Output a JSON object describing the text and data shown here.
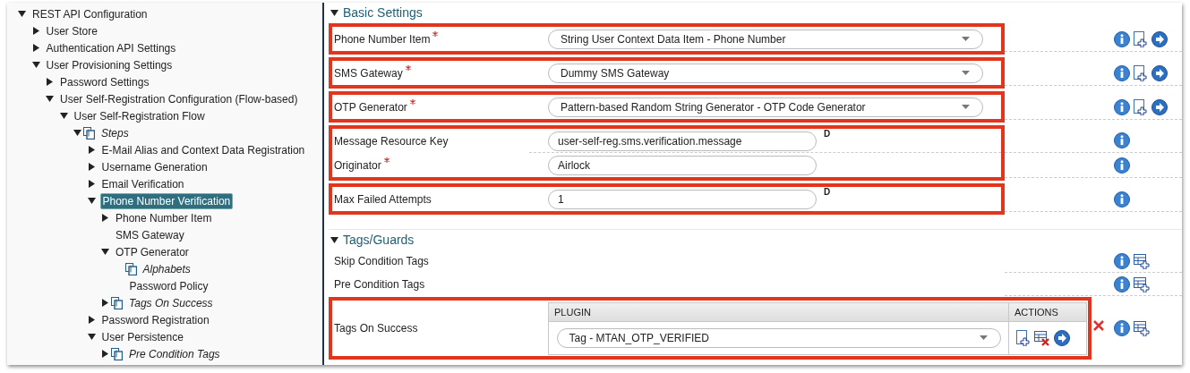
{
  "tree": [
    {
      "label": "REST API Configuration",
      "kind": "branch",
      "expanded": true,
      "collection": false,
      "selected": false,
      "children": [
        {
          "label": "User Store",
          "kind": "branch",
          "expanded": false,
          "collection": false,
          "selected": false
        },
        {
          "label": "Authentication API Settings",
          "kind": "branch",
          "expanded": false,
          "collection": false,
          "selected": false
        },
        {
          "label": "User Provisioning Settings",
          "kind": "branch",
          "expanded": true,
          "collection": false,
          "selected": false,
          "children": [
            {
              "label": "Password Settings",
              "kind": "branch",
              "expanded": false,
              "collection": false,
              "selected": false
            },
            {
              "label": "User Self-Registration Configuration (Flow-based)",
              "kind": "branch",
              "expanded": true,
              "collection": false,
              "selected": false,
              "children": [
                {
                  "label": "User Self-Registration Flow",
                  "kind": "branch",
                  "expanded": true,
                  "collection": false,
                  "selected": false,
                  "children": [
                    {
                      "label": "Steps",
                      "kind": "branch",
                      "expanded": true,
                      "collection": true,
                      "selected": false,
                      "children": [
                        {
                          "label": "E-Mail Alias and Context Data Registration",
                          "kind": "branch",
                          "expanded": false,
                          "collection": false,
                          "selected": false
                        },
                        {
                          "label": "Username Generation",
                          "kind": "branch",
                          "expanded": false,
                          "collection": false,
                          "selected": false
                        },
                        {
                          "label": "Email Verification",
                          "kind": "branch",
                          "expanded": false,
                          "collection": false,
                          "selected": false
                        },
                        {
                          "label": "Phone Number Verification",
                          "kind": "branch",
                          "expanded": true,
                          "collection": false,
                          "selected": true,
                          "children": [
                            {
                              "label": "Phone Number Item",
                              "kind": "branch",
                              "expanded": false,
                              "collection": false,
                              "selected": false
                            },
                            {
                              "label": "SMS Gateway",
                              "kind": "leaf",
                              "collection": false,
                              "selected": false
                            },
                            {
                              "label": "OTP Generator",
                              "kind": "branch",
                              "expanded": true,
                              "collection": false,
                              "selected": false,
                              "children": [
                                {
                                  "label": "Alphabets",
                                  "kind": "leaf",
                                  "collection": true,
                                  "selected": false
                                },
                                {
                                  "label": "Password Policy",
                                  "kind": "leaf",
                                  "collection": false,
                                  "selected": false
                                }
                              ]
                            },
                            {
                              "label": "Tags On Success",
                              "kind": "branch",
                              "expanded": false,
                              "collection": true,
                              "selected": false
                            }
                          ]
                        },
                        {
                          "label": "Password Registration",
                          "kind": "branch",
                          "expanded": false,
                          "collection": false,
                          "selected": false
                        },
                        {
                          "label": "User Persistence",
                          "kind": "branch",
                          "expanded": true,
                          "collection": false,
                          "selected": false,
                          "children": [
                            {
                              "label": "Pre Condition Tags",
                              "kind": "branch",
                              "expanded": false,
                              "collection": true,
                              "selected": false
                            }
                          ]
                        }
                      ]
                    }
                  ]
                }
              ]
            }
          ]
        }
      ]
    }
  ],
  "sections": [
    {
      "title": "Basic Settings",
      "expanded": true,
      "groups": [
        {
          "highlighted": true,
          "rows": [
            {
              "label": "Phone Number Item",
              "required": true,
              "field": {
                "kind": "select",
                "value": "String User Context Data Item - Phone Number"
              },
              "actions": [
                {
                  "kind": "info"
                },
                {
                  "kind": "add"
                },
                {
                  "kind": "goto"
                }
              ]
            }
          ]
        },
        {
          "highlighted": true,
          "rows": [
            {
              "label": "SMS Gateway",
              "required": true,
              "field": {
                "kind": "select",
                "value": "Dummy SMS Gateway"
              },
              "actions": [
                {
                  "kind": "info"
                },
                {
                  "kind": "add"
                },
                {
                  "kind": "goto"
                }
              ]
            }
          ]
        },
        {
          "highlighted": true,
          "rows": [
            {
              "label": "OTP Generator",
              "required": true,
              "field": {
                "kind": "select",
                "value": "Pattern-based Random String Generator - OTP Code Generator"
              },
              "actions": [
                {
                  "kind": "info"
                },
                {
                  "kind": "add"
                },
                {
                  "kind": "goto"
                }
              ]
            }
          ]
        },
        {
          "highlighted": true,
          "rows": [
            {
              "label": "Message Resource Key",
              "required": false,
              "field": {
                "kind": "text",
                "value": "user-self-reg.sms.verification.message"
              },
              "marker": "D",
              "actions": [
                {
                  "kind": "info"
                }
              ]
            },
            {
              "label": "Originator",
              "required": true,
              "field": {
                "kind": "text",
                "value": "Airlock"
              },
              "actions": [
                {
                  "kind": "info"
                }
              ]
            }
          ]
        },
        {
          "highlighted": true,
          "rows": [
            {
              "label": "Max Failed Attempts",
              "required": false,
              "field": {
                "kind": "text",
                "value": "1"
              },
              "marker": "D",
              "actions": [
                {
                  "kind": "info"
                }
              ]
            }
          ]
        }
      ]
    },
    {
      "title": "Tags/Guards",
      "expanded": true,
      "groups": [
        {
          "highlighted": false,
          "rows": [
            {
              "label": "Skip Condition Tags",
              "required": false,
              "field": {
                "kind": "none"
              },
              "actions": [
                {
                  "kind": "info"
                },
                {
                  "kind": "table-add"
                }
              ]
            }
          ]
        },
        {
          "highlighted": false,
          "rows": [
            {
              "label": "Pre Condition Tags",
              "required": false,
              "field": {
                "kind": "none"
              },
              "actions": [
                {
                  "kind": "info"
                },
                {
                  "kind": "table-add"
                }
              ]
            }
          ]
        },
        {
          "highlighted": true,
          "rows": [
            {
              "label": "Tags On Success",
              "required": false,
              "removable": true,
              "field": {
                "kind": "table",
                "columns": [
                  "PLUGIN",
                  "ACTIONS"
                ],
                "rows": [
                  {
                    "value": "Tag - MTAN_OTP_VERIFIED",
                    "actions": [
                      {
                        "kind": "add"
                      },
                      {
                        "kind": "delete"
                      },
                      {
                        "kind": "goto"
                      }
                    ]
                  }
                ]
              },
              "actions": [
                {
                  "kind": "info"
                },
                {
                  "kind": "table-add"
                }
              ]
            }
          ]
        }
      ]
    }
  ]
}
